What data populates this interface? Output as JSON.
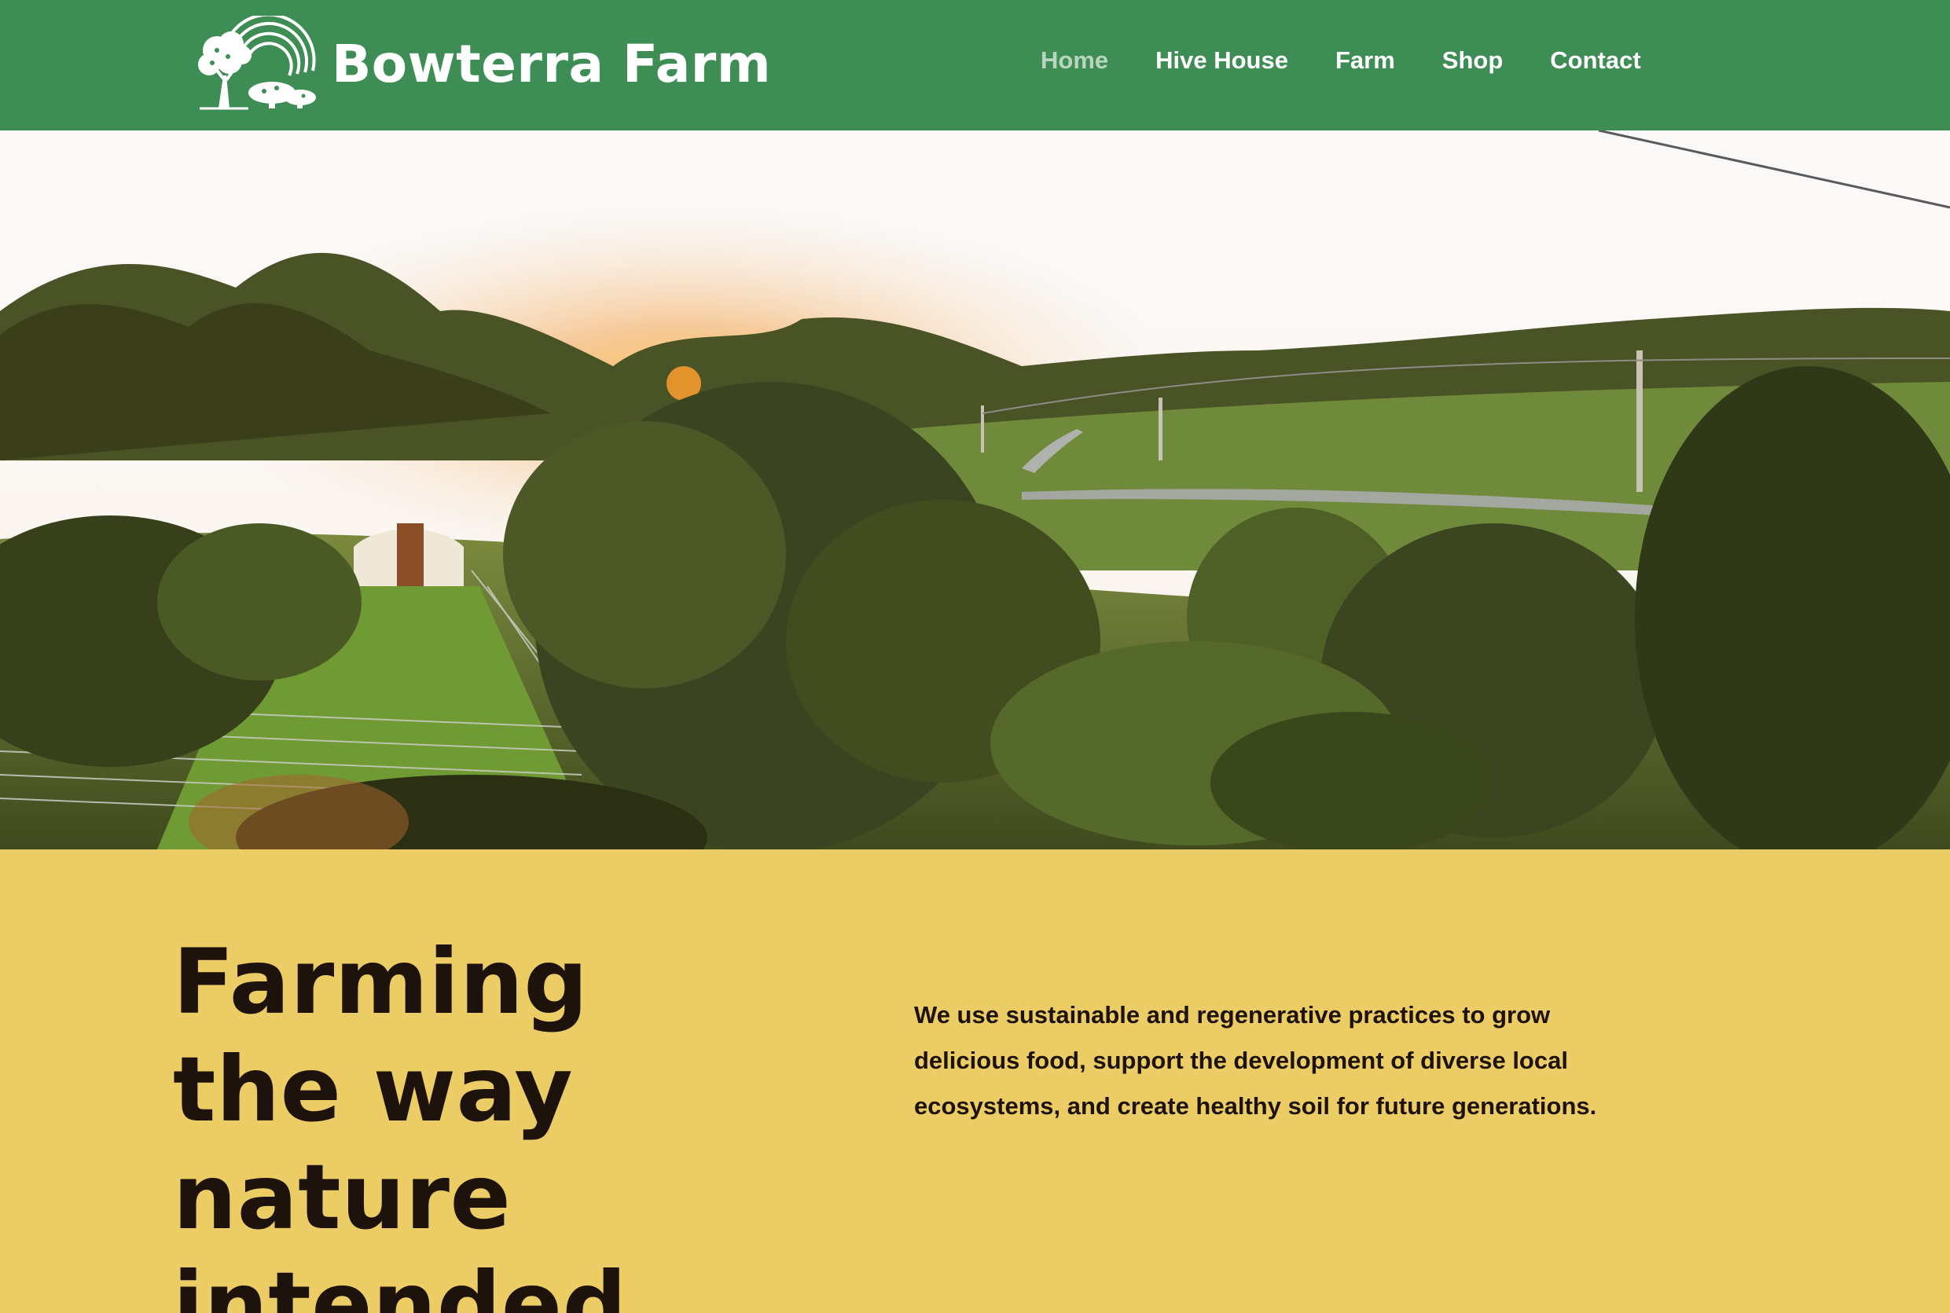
{
  "header": {
    "brand_name": "Bowterra Farm",
    "logo_icon": "tree-and-rainbow-logo",
    "colors": {
      "background": "#3e8d54",
      "text": "#ffffff",
      "active_link": "#b9d5c0"
    },
    "nav": [
      {
        "label": "Home",
        "active": true
      },
      {
        "label": "Hive House",
        "active": false
      },
      {
        "label": "Farm",
        "active": false
      },
      {
        "label": "Shop",
        "active": false
      },
      {
        "label": "Contact",
        "active": false
      }
    ]
  },
  "hero": {
    "image_subject": "farm-landscape-at-sunset"
  },
  "intro": {
    "heading": "Farming the way nature intended.",
    "body": "We use sustainable and regenerative practices to grow delicious food, support the development of diverse local ecosystems, and create healthy soil for future generations.",
    "colors": {
      "background": "#ebcc65",
      "text": "#1e120c"
    }
  }
}
